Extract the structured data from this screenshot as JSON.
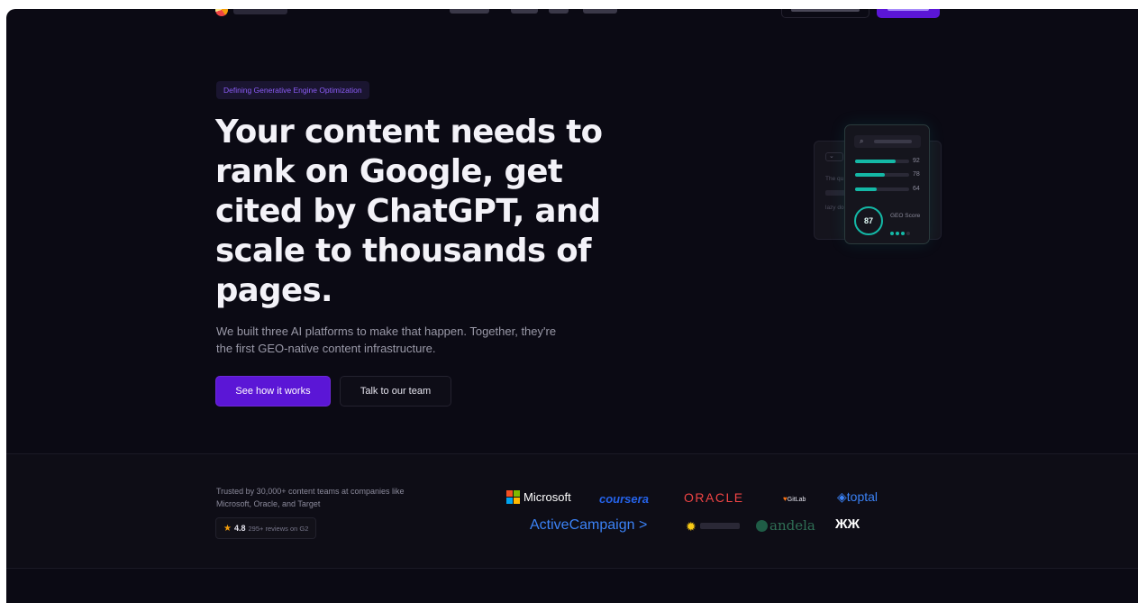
{
  "hero": {
    "eyebrow": "Defining Generative Engine Optimization",
    "title": "Your content needs to rank on Google, get cited by ChatGPT, and scale to thousands of pages.",
    "subtitle": "We built three AI platforms to make that happen. Together, they're the first GEO-native content infrastructure.",
    "primary_cta": "See how it works",
    "secondary_cta": "Talk to our team"
  },
  "illustration": {
    "back_card_lines": [
      "The qu",
      "lazy do"
    ],
    "metrics": [
      {
        "value": "92",
        "fill": 0.75
      },
      {
        "value": "78",
        "fill": 0.55
      },
      {
        "value": "64",
        "fill": 0.4
      }
    ],
    "score": "87",
    "score_label": "GEO Score",
    "dots_on": 3,
    "dots_total": 4
  },
  "trust": {
    "text": "Trusted by 30,000+ content teams at companies like Microsoft, Oracle, and Target",
    "rating": "4.8",
    "reviews": "295+ reviews on G2",
    "logos": {
      "microsoft": "Microsoft",
      "coursera": "coursera",
      "oracle": "ORACLE",
      "gitlab": "GitLab",
      "toptal": "toptal",
      "activecampaign": "ActiveCampaign >",
      "andela": "andela"
    }
  },
  "colors": {
    "background": "#0b0a14",
    "accent": "#5b16d6",
    "teal": "#14b8a6"
  }
}
